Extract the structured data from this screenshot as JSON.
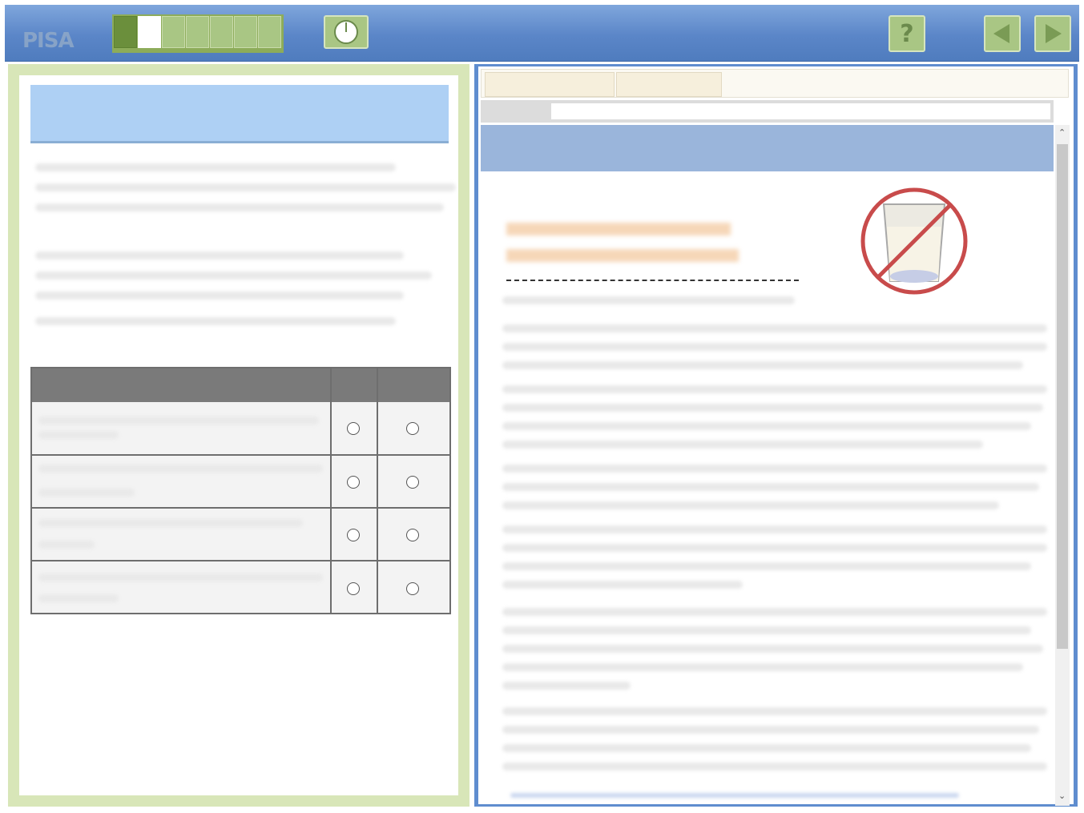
{
  "app": {
    "logo": "PISA"
  },
  "progress": {
    "segments_total": 7,
    "segments_done": 1,
    "current_index": 2
  },
  "toolbar": {
    "help_label": "?"
  },
  "question": {
    "radio_rows": 4,
    "radio_cols": 2
  },
  "colors": {
    "topbar": "#5b86c8",
    "accent_green": "#a9c684",
    "left_frame": "#d8e6b8",
    "right_frame": "#5f8dcf",
    "header_blue": "#aed0f4",
    "no_sign_red": "#c84b4b"
  },
  "icons": {
    "timer": "clock-icon",
    "help": "question-icon",
    "back": "left-arrow-icon",
    "next": "right-arrow-icon",
    "article_image": "no-milk-glass-icon"
  }
}
